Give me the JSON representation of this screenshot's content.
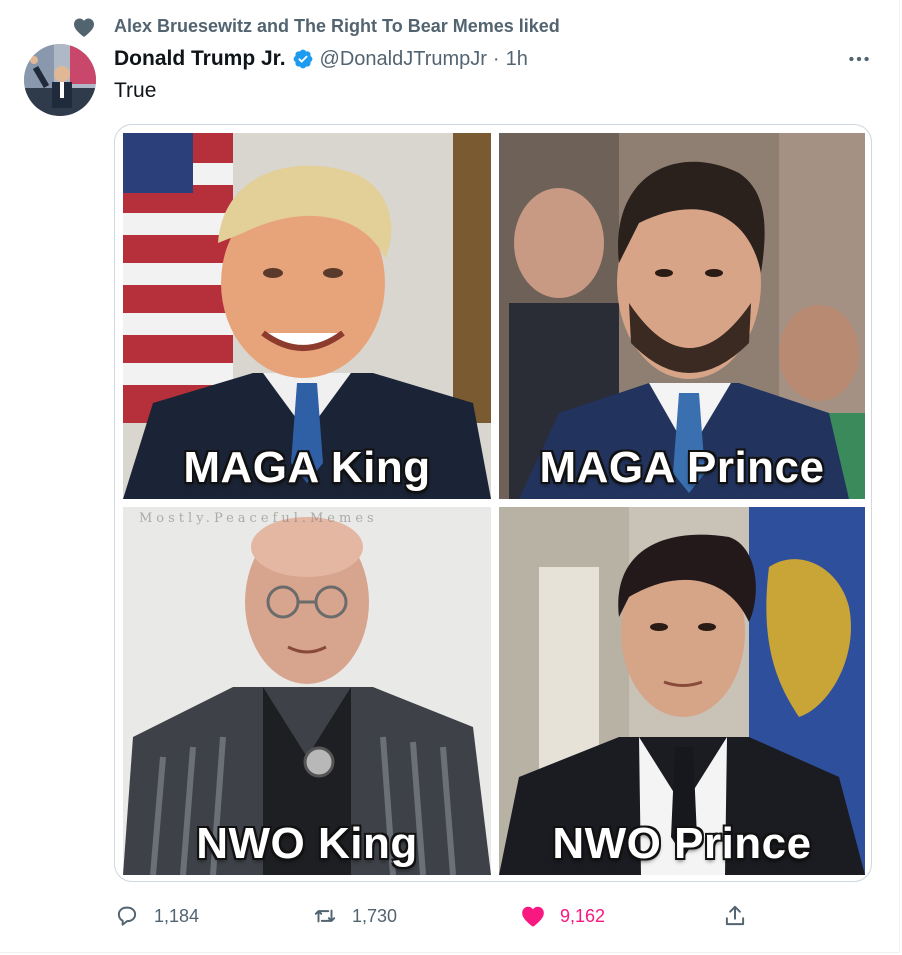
{
  "social_context": {
    "icon": "heart-icon",
    "text": "Alex Bruesewitz and The Right To Bear Memes liked"
  },
  "author": {
    "display_name": "Donald Trump Jr.",
    "verified": true,
    "handle": "@DonaldJTrumpJr",
    "separator": "·",
    "time": "1h"
  },
  "tweet": {
    "text": "True"
  },
  "media": {
    "watermark": "Mostly.Peaceful.Memes",
    "panels": [
      {
        "caption": "MAGA King"
      },
      {
        "caption": "MAGA Prince"
      },
      {
        "caption": "NWO King"
      },
      {
        "caption": "NWO Prince"
      }
    ]
  },
  "actions": {
    "reply": {
      "icon": "reply-icon",
      "count": "1,184"
    },
    "retweet": {
      "icon": "retweet-icon",
      "count": "1,730"
    },
    "like": {
      "icon": "heart-filled-icon",
      "count": "9,162",
      "liked": true
    },
    "share": {
      "icon": "share-icon"
    }
  },
  "colors": {
    "verified": "#1d9bf0",
    "liked": "#f91880",
    "secondary_text": "#536471"
  }
}
